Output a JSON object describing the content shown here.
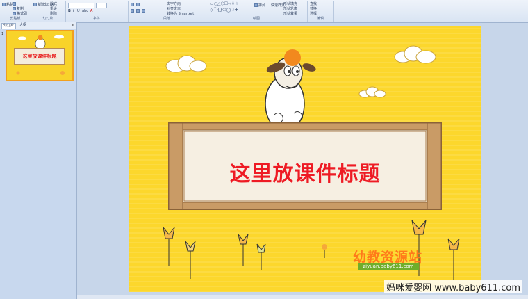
{
  "ribbon": {
    "groups": [
      {
        "label": "剪贴板"
      },
      {
        "label": "幻灯片"
      },
      {
        "label": "字体"
      },
      {
        "label": "段落"
      },
      {
        "label": "绘图"
      },
      {
        "label": "编辑"
      }
    ],
    "buttons": {
      "paste": "粘贴",
      "copy": "复制",
      "format": "格式刷",
      "new_slide": "新建幻灯片",
      "layout": "版式",
      "reset": "重设",
      "delete": "删除",
      "text_direction": "文字方向",
      "align_text": "对齐文本",
      "convert_smartart": "转换为 SmartArt",
      "arrange": "排列",
      "quick_styles": "快速样式",
      "shape_fill": "形状填充",
      "shape_outline": "形状轮廓",
      "shape_effects": "形状效果",
      "find": "查找",
      "replace": "替换",
      "select": "选择"
    }
  },
  "left_pane": {
    "tabs": [
      "幻灯片",
      "大纲"
    ],
    "close": "×",
    "slide_number": "1",
    "thumb_title": "这里放课件标题"
  },
  "slide": {
    "title": "这里放课件标题",
    "brand": "幼教资源站",
    "brand_url": "ziyuan.baby611.com"
  },
  "watermark": "妈咪爱婴网 www.baby611.com",
  "colors": {
    "slide_bg": "#fcd72c",
    "title": "#ee1b24",
    "banner_fill": "#f4ecdc",
    "banner_border": "#b58a57",
    "ribbon": "#dfe8f5"
  }
}
